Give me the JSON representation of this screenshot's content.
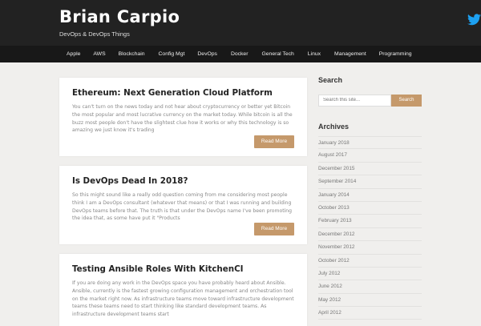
{
  "header": {
    "site_title": "Brian Carpio",
    "tagline": "DevOps & DevOps Things"
  },
  "nav": {
    "items": [
      {
        "label": "Apple"
      },
      {
        "label": "AWS"
      },
      {
        "label": "Blockchain"
      },
      {
        "label": "Config Mgt"
      },
      {
        "label": "DevOps"
      },
      {
        "label": "Docker"
      },
      {
        "label": "General Tech"
      },
      {
        "label": "Linux"
      },
      {
        "label": "Management"
      },
      {
        "label": "Programming"
      }
    ]
  },
  "posts": [
    {
      "title": "Ethereum: Next Generation Cloud Platform",
      "excerpt": "You can't turn on the news today and not hear about cryptocurrency or better yet Bitcoin the most popular and most lucrative currency on the market today. While bitcoin is all the buzz most people don't have the slightest clue how it works or why this technology is so amazing we just know it's trading",
      "button": "Read More"
    },
    {
      "title": "Is DevOps Dead In 2018?",
      "excerpt": "So this might sound like a really odd question coming from me considering most people think I am a DevOps consultant (whatever that means) or that I was running and building DevOps teams before that. The truth is that under the DevOps name I've been promoting the idea that, as some have put it \"Products",
      "button": "Read More"
    },
    {
      "title": "Testing Ansible Roles With KitchenCI",
      "excerpt": "If you are doing any work in the DevOps space you have probably heard about Ansible. Ansible, currently is the fastest growing configuration management and orchestration tool on the market right now. As infrastructure teams move toward infrastructure development teams these teams need to start thinking like standard development teams. As infrastructure development teams start",
      "button": "Read More"
    }
  ],
  "sidebar": {
    "search_title": "Search",
    "search_placeholder": "Search this site...",
    "search_button": "Search",
    "archives_title": "Archives",
    "archives": [
      "January 2018",
      "August 2017",
      "December 2015",
      "September 2014",
      "January 2014",
      "October 2013",
      "February 2013",
      "December 2012",
      "November 2012",
      "October 2012",
      "July 2012",
      "June 2012",
      "May 2012",
      "April 2012"
    ]
  }
}
